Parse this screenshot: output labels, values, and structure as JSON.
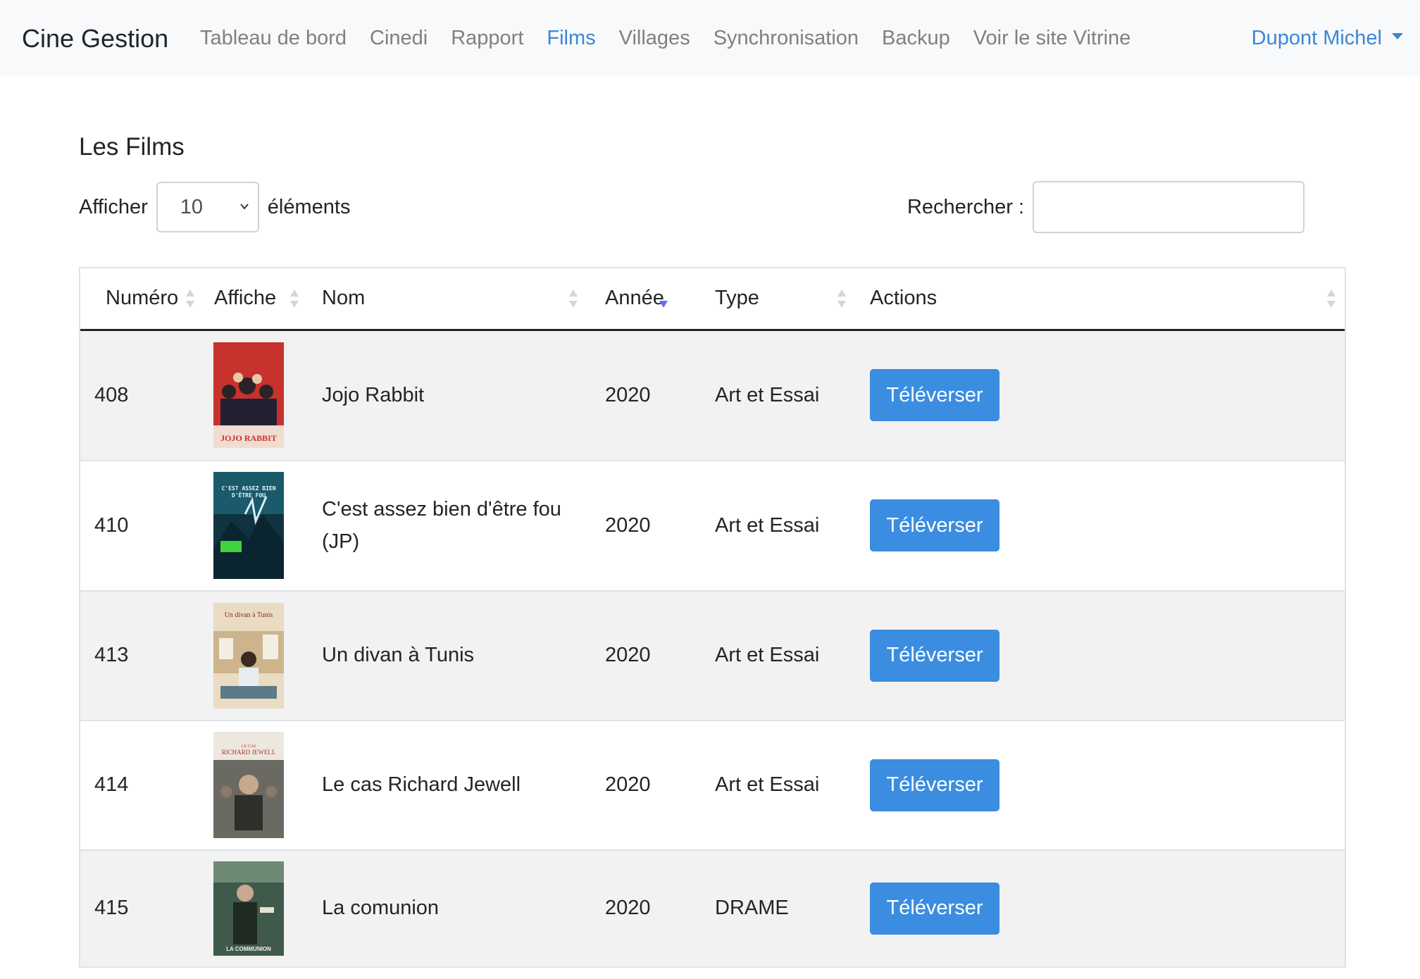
{
  "navbar": {
    "brand": "Cine Gestion",
    "items": [
      {
        "label": "Tableau de bord",
        "active": false
      },
      {
        "label": "Cinedi",
        "active": false
      },
      {
        "label": "Rapport",
        "active": false
      },
      {
        "label": "Films",
        "active": true
      },
      {
        "label": "Villages",
        "active": false
      },
      {
        "label": "Synchronisation",
        "active": false
      },
      {
        "label": "Backup",
        "active": false
      },
      {
        "label": "Voir le site Vitrine",
        "active": false
      }
    ],
    "user": "Dupont Michel"
  },
  "page": {
    "title": "Les Films",
    "length_prefix": "Afficher",
    "length_value": "10",
    "length_suffix": "éléments",
    "search_label": "Recherher :",
    "search_value": ""
  },
  "table": {
    "columns": [
      "Numéro",
      "Affiche",
      "Nom",
      "Année",
      "Type",
      "Actions"
    ],
    "sorted_column": "Année",
    "rows": [
      {
        "numero": "408",
        "poster": "jojo-rabbit-poster",
        "poster_text": "JOJO RABBIT",
        "nom": "Jojo Rabbit",
        "annee": "2020",
        "type": "Art et Essai",
        "action": "Téléverser"
      },
      {
        "numero": "410",
        "poster": "cest-assez-bien-poster",
        "poster_text": "C'EST ASSEZ BIEN D'ÊTRE FOU",
        "nom": "C'est assez bien d'être fou (JP)",
        "annee": "2020",
        "type": "Art et Essai",
        "action": "Téléverser"
      },
      {
        "numero": "413",
        "poster": "un-divan-a-tunis-poster",
        "poster_text": "Un divan à Tunis",
        "nom": "Un divan à Tunis",
        "annee": "2020",
        "type": "Art et Essai",
        "action": "Téléverser"
      },
      {
        "numero": "414",
        "poster": "richard-jewell-poster",
        "poster_text": "RICHARD JEWELL",
        "nom": "Le cas Richard Jewell",
        "annee": "2020",
        "type": "Art et Essai",
        "action": "Téléverser"
      },
      {
        "numero": "415",
        "poster": "la-communion-poster",
        "poster_text": "LA COMMUNION",
        "nom": "La comunion",
        "annee": "2020",
        "type": "DRAME",
        "action": "Téléverser"
      }
    ]
  },
  "colors": {
    "accent": "#3a87d8",
    "button": "#3a8de0",
    "navbar_bg": "#f8f9fa",
    "row_stripe": "#f2f2f2"
  }
}
